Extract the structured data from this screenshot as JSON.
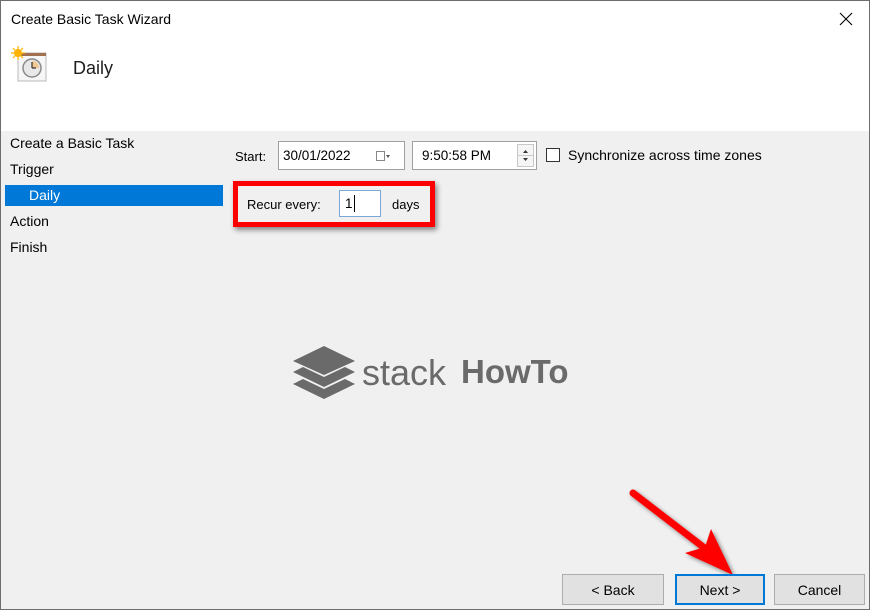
{
  "window": {
    "title": "Create Basic Task Wizard",
    "close_icon": "close-icon"
  },
  "header": {
    "icon": "scheduled-task-clock-icon",
    "title": "Daily"
  },
  "sidebar": {
    "items": [
      {
        "label": "Create a Basic Task",
        "active": false,
        "sub": false
      },
      {
        "label": "Trigger",
        "active": false,
        "sub": false
      },
      {
        "label": "Daily",
        "active": true,
        "sub": true
      },
      {
        "label": "Action",
        "active": false,
        "sub": false
      },
      {
        "label": "Finish",
        "active": false,
        "sub": false
      }
    ],
    "active_color": "#0078d7"
  },
  "form": {
    "start_label": "Start:",
    "start_date": "30/01/2022",
    "date_picker_icon": "calendar-dropdown-icon",
    "start_time": "9:50:58 PM",
    "time_spinner_icon": "spin-up-down-icon",
    "sync_label": "Synchronize across time zones",
    "sync_checked": false,
    "recur_label": "Recur every:",
    "recur_value": "1",
    "recur_unit": "days"
  },
  "annotation": {
    "highlight_color": "#ff0000",
    "arrow_color": "#ff0000"
  },
  "watermark": {
    "icon": "stack-layers-icon",
    "text_light": "stack",
    "text_bold": "HowTo"
  },
  "buttons": {
    "back": "< Back",
    "next": "Next >",
    "cancel": "Cancel"
  }
}
